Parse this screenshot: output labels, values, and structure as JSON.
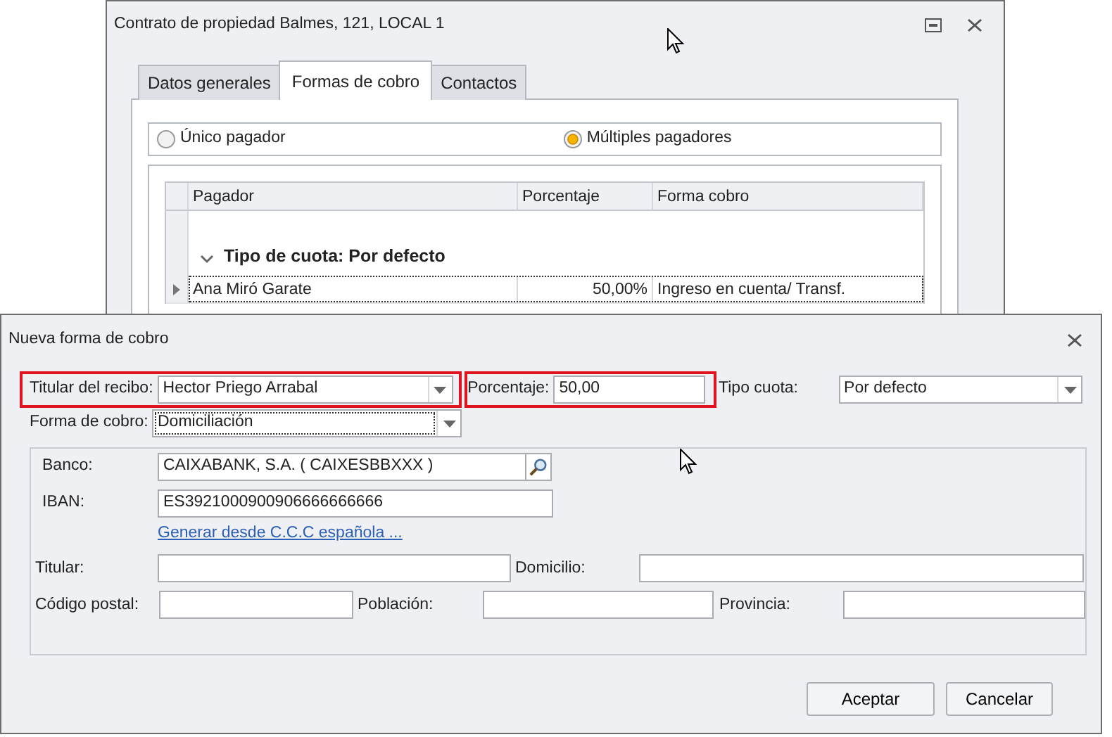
{
  "back_window": {
    "title": "Contrato de propiedad Balmes, 121, LOCAL 1",
    "tabs": [
      {
        "label": "Datos generales",
        "selected": false
      },
      {
        "label": "Formas de cobro",
        "selected": true
      },
      {
        "label": "Contactos",
        "selected": false
      }
    ],
    "payer_options": [
      {
        "label": "Único pagador",
        "selected": false
      },
      {
        "label": "Múltiples pagadores",
        "selected": true
      }
    ],
    "table": {
      "columns": [
        "Pagador",
        "Porcentaje",
        "Forma cobro"
      ],
      "group": {
        "label": "Tipo de cuota: Por defecto",
        "expanded": true
      },
      "rows": [
        {
          "cells": [
            "Ana Miró Garate",
            "50,00%",
            "Ingreso en cuenta/ Transf."
          ],
          "selected": true
        }
      ]
    }
  },
  "dialog": {
    "title": "Nueva forma de cobro",
    "receipt_holder": {
      "label": "Titular del recibo:",
      "value": "Hector Priego Arrabal",
      "highlighted": true
    },
    "percentage": {
      "label": "Porcentaje:",
      "value": "50,00",
      "highlighted": true
    },
    "fee_type": {
      "label": "Tipo cuota:",
      "value": "Por defecto"
    },
    "payment_method": {
      "label": "Forma de cobro:",
      "value": "Domiciliación",
      "focused": true
    },
    "bank": {
      "label": "Banco:",
      "value": "CAIXABANK, S.A. ( CAIXESBBXXX )"
    },
    "iban": {
      "label": "IBAN:",
      "value": "ES3921000900906666666666"
    },
    "generate_link": "Generar desde C.C.C española ...",
    "holder": {
      "label": "Titular:"
    },
    "address": {
      "label": "Domicilio:"
    },
    "postal_code": {
      "label": "Código postal:"
    },
    "town": {
      "label": "Población:"
    },
    "province": {
      "label": "Provincia:"
    },
    "buttons": [
      "Aceptar",
      "Cancelar"
    ]
  }
}
